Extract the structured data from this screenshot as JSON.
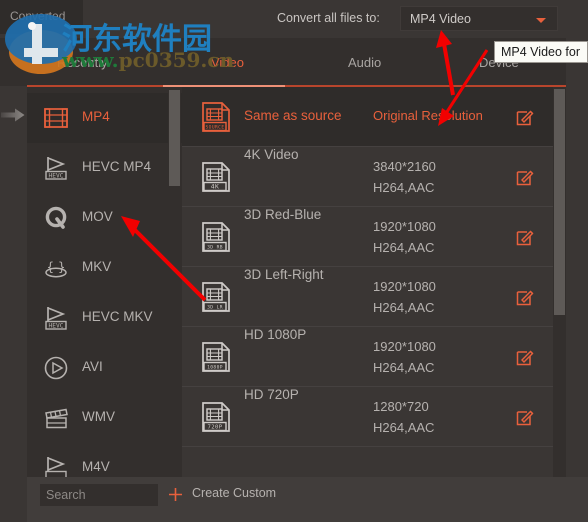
{
  "topbar": {
    "converted_tab_label": "Converted",
    "convert_all_label": "Convert all files to:",
    "format_value": "MP4 Video",
    "caret_icon": "chevron-down-icon"
  },
  "tooltip": {
    "text": "MP4 Video for"
  },
  "tabs": [
    {
      "label": "Recently",
      "active": false
    },
    {
      "label": "Video",
      "active": true
    },
    {
      "label": "Audio",
      "active": false
    },
    {
      "label": "Device",
      "active": false
    }
  ],
  "sidebar": {
    "items": [
      {
        "label": "MP4",
        "icon": "film-strip-icon",
        "active": true
      },
      {
        "label": "HEVC MP4",
        "icon": "hevc-flag-icon",
        "active": false
      },
      {
        "label": "MOV",
        "icon": "quicktime-q-icon",
        "active": false
      },
      {
        "label": "MKV",
        "icon": "matroska-icon",
        "active": false
      },
      {
        "label": "HEVC MKV",
        "icon": "hevc-flag-icon",
        "active": false
      },
      {
        "label": "AVI",
        "icon": "play-circle-icon",
        "active": false
      },
      {
        "label": "WMV",
        "icon": "clapperboard-icon",
        "active": false
      },
      {
        "label": "M4V",
        "icon": "flag-icon",
        "active": false
      }
    ]
  },
  "presets": [
    {
      "name": "Same as source",
      "resolution": "Original Resolution",
      "codec": "",
      "icon": "source-file-icon",
      "badge": "SOURCE",
      "selected": true,
      "edit_icon": "edit-pencil-icon"
    },
    {
      "name": "4K Video",
      "resolution": "3840*2160",
      "codec": "H264,AAC",
      "icon": "video-file-icon",
      "badge": "4K",
      "selected": false,
      "edit_icon": "edit-pencil-icon"
    },
    {
      "name": "3D Red-Blue",
      "resolution": "1920*1080",
      "codec": "H264,AAC",
      "icon": "video-file-icon",
      "badge": "3D RB",
      "selected": false,
      "edit_icon": "edit-pencil-icon"
    },
    {
      "name": "3D Left-Right",
      "resolution": "1920*1080",
      "codec": "H264,AAC",
      "icon": "video-file-icon",
      "badge": "3D LR",
      "selected": false,
      "edit_icon": "edit-pencil-icon"
    },
    {
      "name": "HD 1080P",
      "resolution": "1920*1080",
      "codec": "H264,AAC",
      "icon": "video-file-icon",
      "badge": "1080P",
      "selected": false,
      "edit_icon": "edit-pencil-icon"
    },
    {
      "name": "HD 720P",
      "resolution": "1280*720",
      "codec": "H264,AAC",
      "icon": "video-file-icon",
      "badge": "720P",
      "selected": false,
      "edit_icon": "edit-pencil-icon"
    }
  ],
  "bottombar": {
    "search_placeholder": "Search",
    "search_value": "",
    "create_custom_label": "Create Custom",
    "plus_icon": "plus-icon"
  },
  "watermark": {
    "chinese": "河东软件园",
    "url_www": "www.",
    "url_domain": "pc0359.cn"
  },
  "colors": {
    "accent": "#e8603c",
    "panel_bg": "#3a3634",
    "sidebar_bg": "#332f2d",
    "text": "#b6b2af",
    "arrow": "#f20000"
  }
}
